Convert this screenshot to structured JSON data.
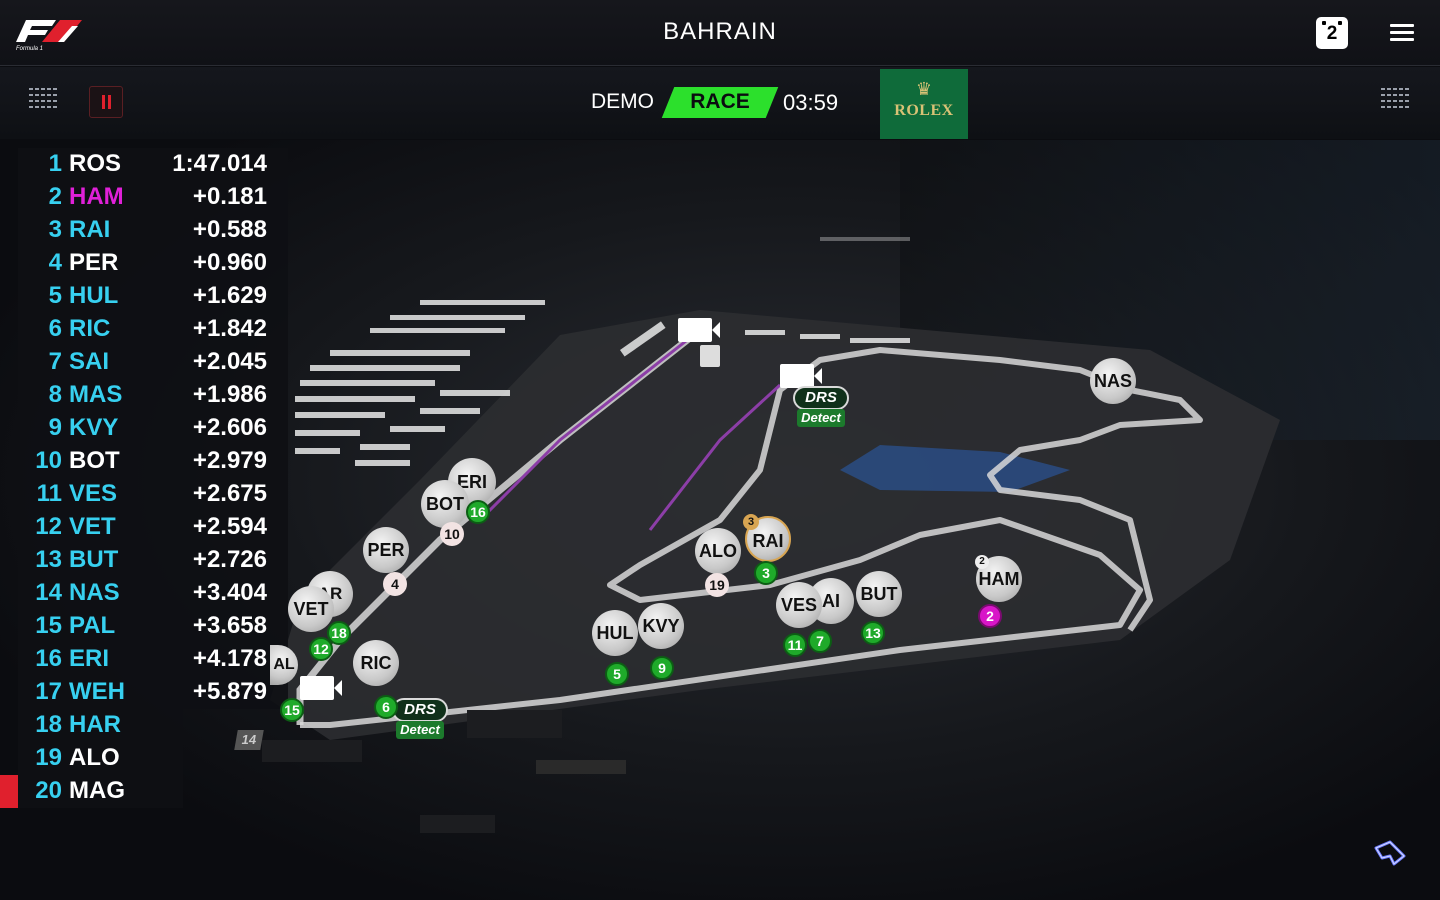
{
  "header": {
    "title": "BAHRAIN",
    "notifications": "2",
    "logo_text": "F1 Formula 1"
  },
  "session": {
    "mode": "DEMO",
    "status": "RACE",
    "clock": "03:59",
    "sponsor": "ROLEX"
  },
  "colors": {
    "race_green": "#2ce02c",
    "pause_red": "#e0202d",
    "rolex_green": "#0f6b3a",
    "ham_magenta": "#e020d8",
    "team_cyan": "#37d0f0"
  },
  "leaderboard": [
    {
      "pos": "1",
      "code": "ROS",
      "gap": "1:47.014"
    },
    {
      "pos": "2",
      "code": "HAM",
      "gap": "+0.181"
    },
    {
      "pos": "3",
      "code": "RAI",
      "gap": "+0.588"
    },
    {
      "pos": "4",
      "code": "PER",
      "gap": "+0.960"
    },
    {
      "pos": "5",
      "code": "HUL",
      "gap": "+1.629"
    },
    {
      "pos": "6",
      "code": "RIC",
      "gap": "+1.842"
    },
    {
      "pos": "7",
      "code": "SAI",
      "gap": "+2.045"
    },
    {
      "pos": "8",
      "code": "MAS",
      "gap": "+1.986"
    },
    {
      "pos": "9",
      "code": "KVY",
      "gap": "+2.606"
    },
    {
      "pos": "10",
      "code": "BOT",
      "gap": "+2.979"
    },
    {
      "pos": "11",
      "code": "VES",
      "gap": "+2.675"
    },
    {
      "pos": "12",
      "code": "VET",
      "gap": "+2.594"
    },
    {
      "pos": "13",
      "code": "BUT",
      "gap": "+2.726"
    },
    {
      "pos": "14",
      "code": "NAS",
      "gap": "+3.404"
    },
    {
      "pos": "15",
      "code": "PAL",
      "gap": "+3.658"
    },
    {
      "pos": "16",
      "code": "ERI",
      "gap": "+4.178"
    },
    {
      "pos": "17",
      "code": "WEH",
      "gap": "+5.879"
    },
    {
      "pos": "18",
      "code": "HAR",
      "gap": ""
    },
    {
      "pos": "19",
      "code": "ALO",
      "gap": ""
    },
    {
      "pos": "20",
      "code": "MAG",
      "gap": ""
    }
  ],
  "drivers": {
    "eri": "ERI",
    "bot": "BOT",
    "per": "PER",
    "har": "AR",
    "vet": "VET",
    "ric": "RIC",
    "alo": "ALO",
    "rai": "RAI",
    "hul": "HUL",
    "kvy": "KVY",
    "ves": "VES",
    "sai": "AI",
    "but": "BUT",
    "ham": "HAM",
    "nas": "NAS",
    "pal": "AL"
  },
  "positions": {
    "n16": "16",
    "n10": "10",
    "n4": "4",
    "n18": "18",
    "n12": "12",
    "n15": "15",
    "n6": "6",
    "n19": "19",
    "n3": "3",
    "n3s": "3",
    "n5": "5",
    "n9": "9",
    "n11": "11",
    "n7": "7",
    "n13": "13",
    "n2": "2",
    "n2s": "2",
    "n14": "14"
  },
  "drs": {
    "line1": "DRS",
    "line2": "Detect"
  }
}
